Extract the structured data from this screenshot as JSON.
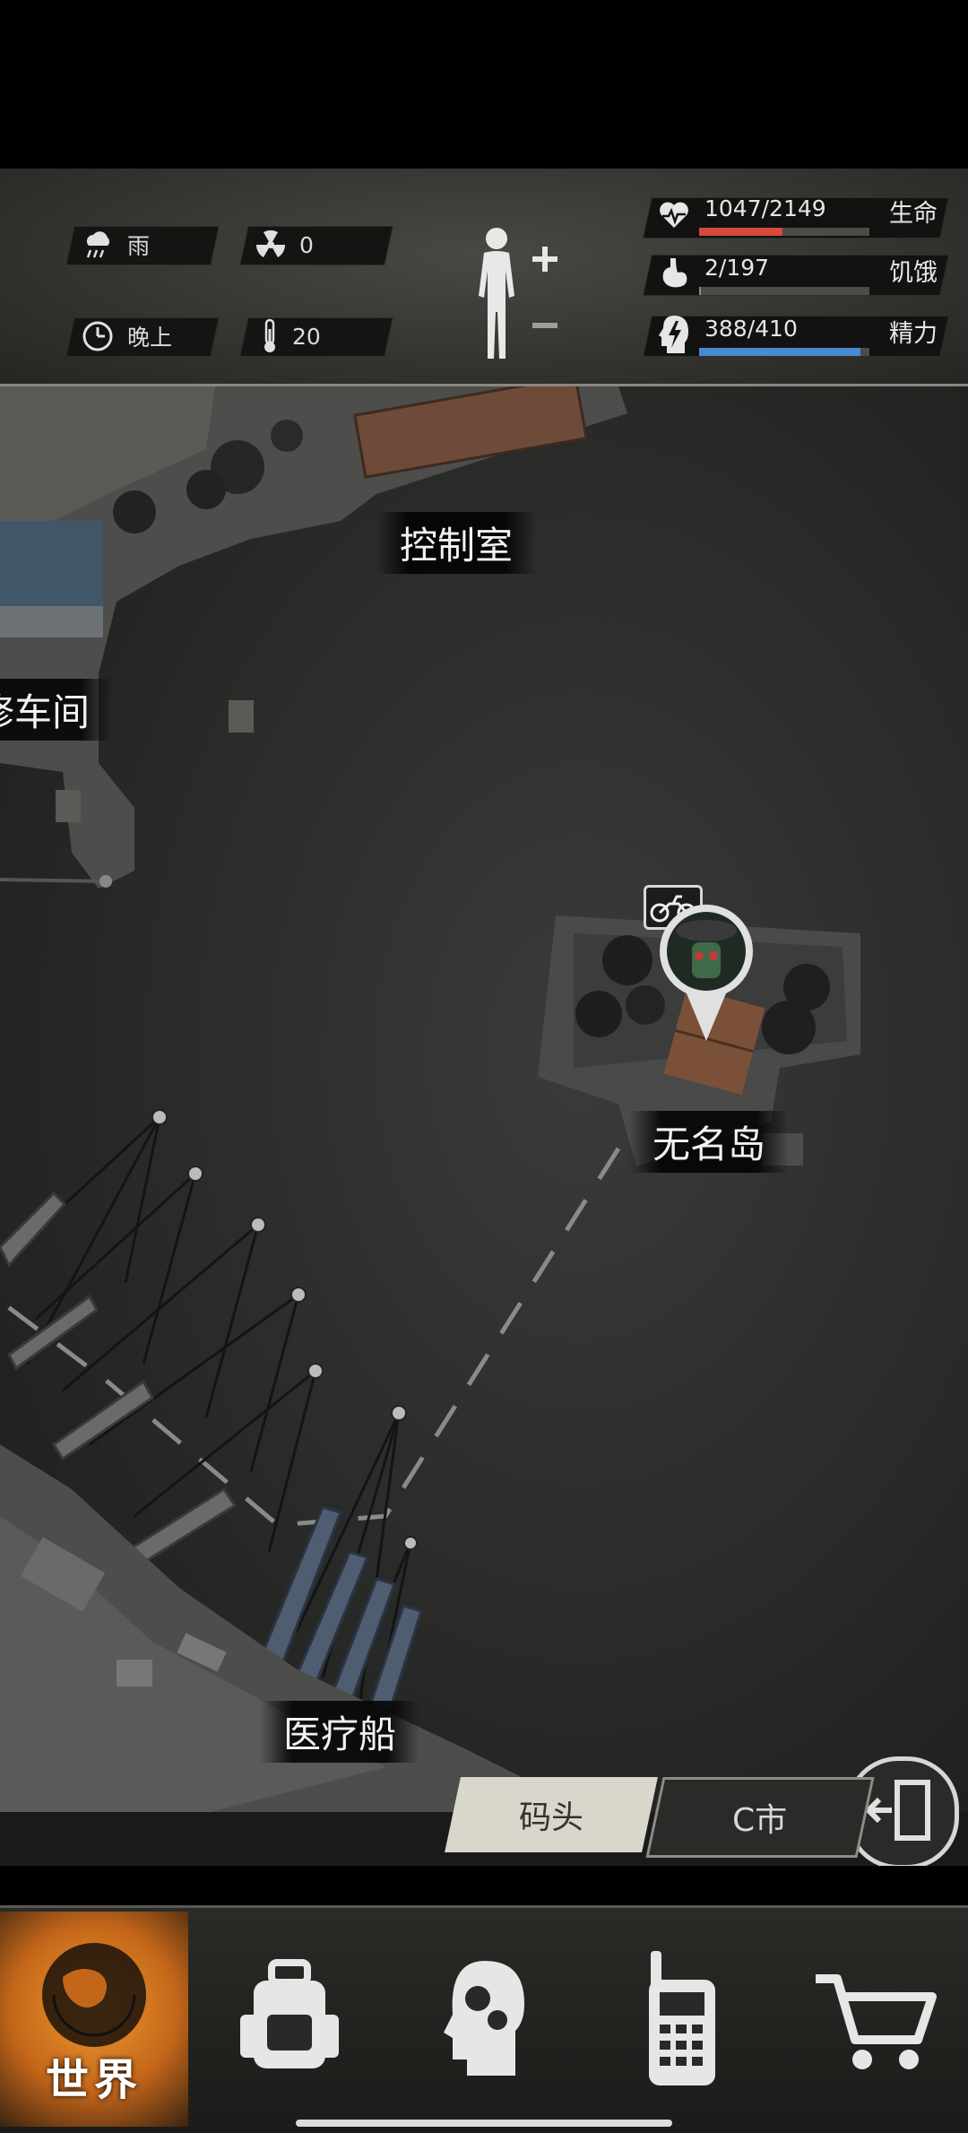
{
  "status": {
    "weather": "雨",
    "radiation": "0",
    "time_of_day": "晚上",
    "temperature": "20"
  },
  "vitals": [
    {
      "value": "1047/2149",
      "label": "生命",
      "fraction": 0.487,
      "color": "#d64a3c"
    },
    {
      "value": "2/197",
      "label": "饥饿",
      "fraction": 0.01,
      "color": "#8a8a8a"
    },
    {
      "value": "388/410",
      "label": "精力",
      "fraction": 0.946,
      "color": "#4a8ad0"
    }
  ],
  "map": {
    "places": [
      "控制室",
      "修车间",
      "无名岛",
      "医疗船"
    ]
  },
  "location_tabs": {
    "current": "码头",
    "destination": "C市"
  },
  "nav": {
    "world_label": "世界",
    "items": [
      "world-icon",
      "backpack-icon",
      "skills-head-icon",
      "radio-icon",
      "shop-cart-icon"
    ]
  },
  "icons": {
    "weather": "rain-cloud-icon",
    "radiation": "radiation-icon",
    "time": "clock-icon",
    "temperature": "thermometer-icon",
    "vehicle": "motorcycle-icon",
    "exit": "exit-door-icon"
  }
}
